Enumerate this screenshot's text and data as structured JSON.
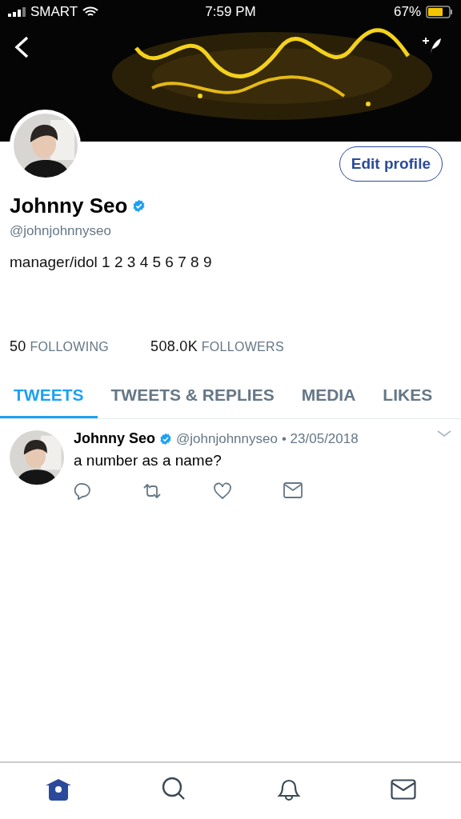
{
  "status_bar": {
    "carrier": "SMART",
    "time": "7:59 PM",
    "battery": "67%"
  },
  "profile": {
    "name": "Johnny Seo",
    "verified": true,
    "handle": "@johnjohnnyseo",
    "bio": "manager/idol 1 2 3 4 5 6 7 8 9",
    "edit_button": "Edit profile"
  },
  "stats": [
    {
      "count": "50",
      "label": "FOLLOWING"
    },
    {
      "count": "508.0K",
      "label": "FOLLOWERS"
    }
  ],
  "tabs": [
    {
      "label": "TWEETS",
      "selected": true
    },
    {
      "label": "TWEETS & REPLIES",
      "selected": false
    },
    {
      "label": "MEDIA",
      "selected": false
    },
    {
      "label": "LIKES",
      "selected": false
    }
  ],
  "tweets": [
    {
      "name": "Johnny Seo",
      "verified": true,
      "handle": "@johnjohnnyseo",
      "date": "• 23/05/2018",
      "text": "a number as a name?"
    }
  ],
  "bottom_nav": [
    {
      "kind": "home",
      "selected": true
    },
    {
      "kind": "search",
      "selected": false
    },
    {
      "kind": "notifications",
      "selected": false
    },
    {
      "kind": "messages",
      "selected": false
    }
  ]
}
